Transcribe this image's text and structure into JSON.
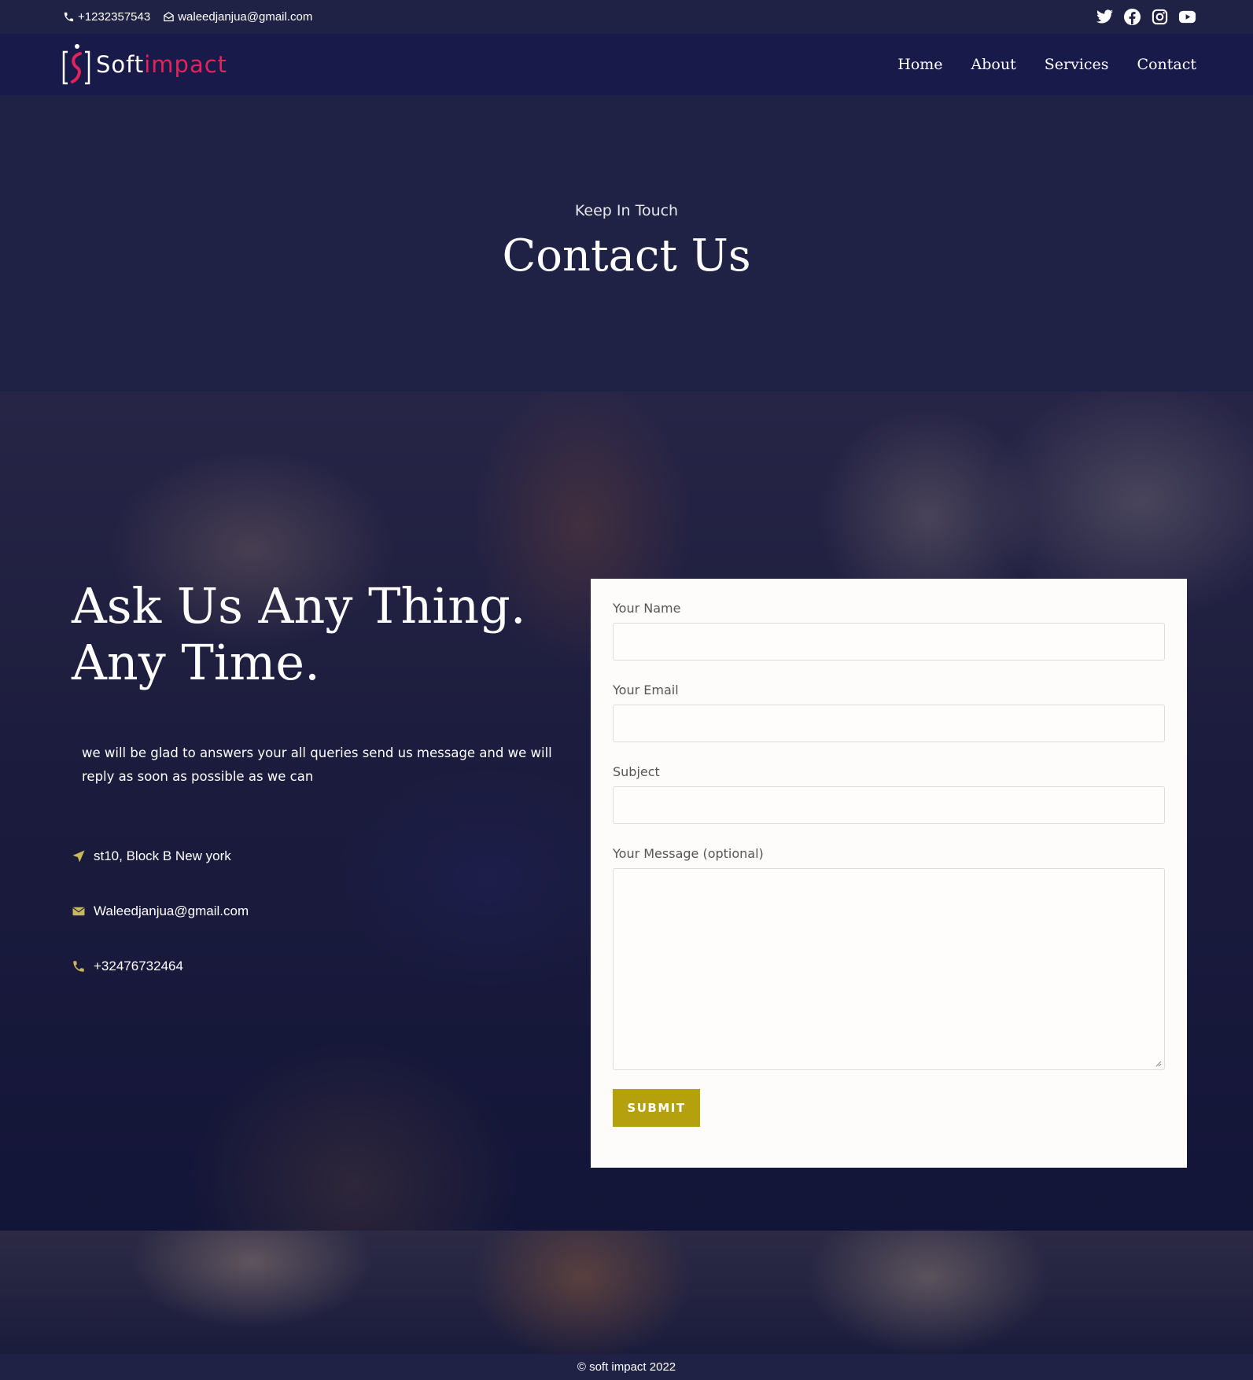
{
  "topbar": {
    "phone": "+1232357543",
    "email": "waleedjanjua@gmail.com",
    "social": [
      {
        "name": "twitter-icon"
      },
      {
        "name": "facebook-icon"
      },
      {
        "name": "instagram-icon"
      },
      {
        "name": "youtube-icon"
      }
    ]
  },
  "brand": {
    "name_soft": "Soft",
    "name_impact": "impact",
    "accent_color": "#e3245a"
  },
  "nav": {
    "items": [
      {
        "label": "Home"
      },
      {
        "label": "About"
      },
      {
        "label": "Services"
      },
      {
        "label": "Contact"
      }
    ]
  },
  "hero": {
    "kicker": "Keep In Touch",
    "title": "Contact Us"
  },
  "contact": {
    "heading_line1": "Ask Us Any Thing.",
    "heading_line2": "Any Time.",
    "lead": "we will be glad  to answers your all queries send us message and we will reply as soon as possible as we can",
    "address": "st10, Block B New york",
    "email": "Waleedjanjua@gmail.com",
    "phone": "+32476732464",
    "icon_color": "#c9b85a"
  },
  "form": {
    "name_label": "Your Name",
    "name_value": "",
    "email_label": "Your Email",
    "email_value": "",
    "subject_label": "Subject",
    "subject_value": "",
    "message_label": "Your Message (optional)",
    "message_value": "",
    "submit_label": "SUBMIT",
    "submit_color": "#b5a00e"
  },
  "footer": {
    "copyright": "© soft impact 2022"
  }
}
